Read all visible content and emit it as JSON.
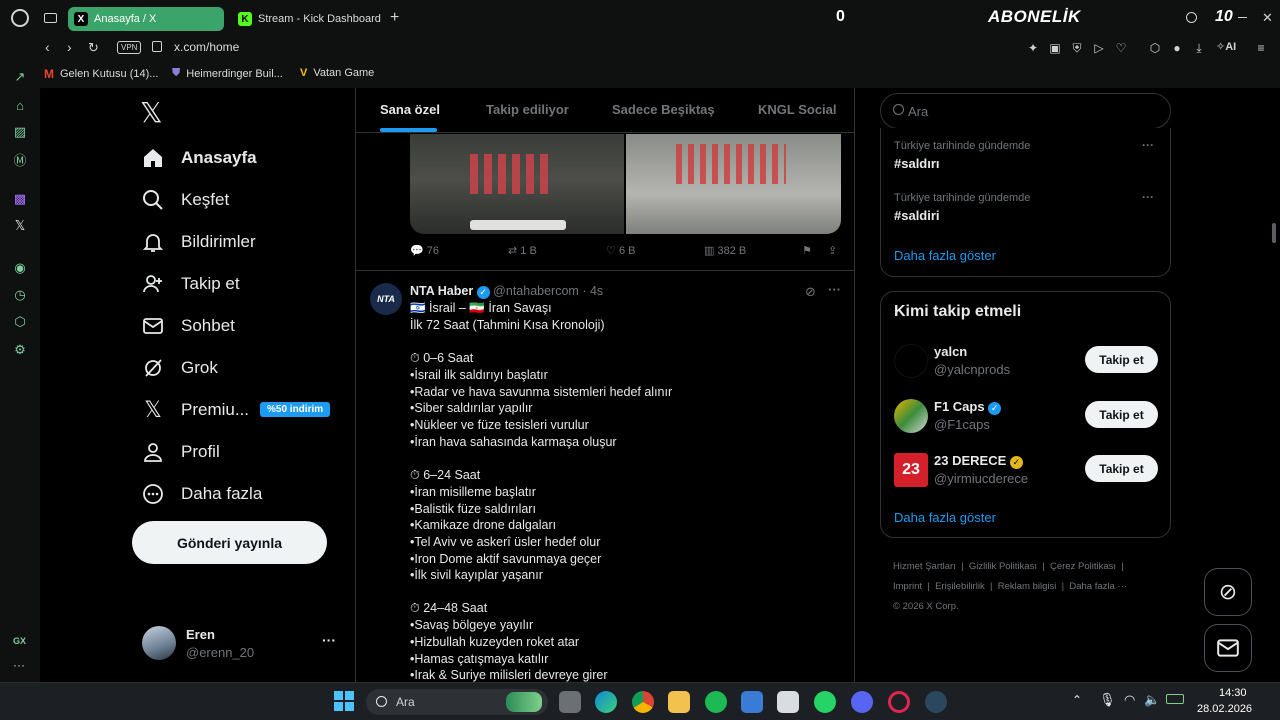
{
  "browser": {
    "tabs": [
      {
        "label": "Anasayfa / X",
        "favicon": "X"
      },
      {
        "label": "Stream - Kick Dashboard",
        "favicon": "K"
      }
    ],
    "add_tab": "+",
    "counter": "0",
    "banner_text": "ABONELİK",
    "search_badge": "10",
    "vpn_label": "VPN",
    "url": "x.com/home",
    "ai_label": "AI",
    "bookmarks": [
      {
        "label": "Gelen Kutusu (14)..."
      },
      {
        "label": "Heimerdinger Buil..."
      },
      {
        "label": "Vatan Game"
      }
    ],
    "gx_label": "GX",
    "accent_color": "#3aa46b"
  },
  "x": {
    "logo": "𝕏",
    "nav": [
      {
        "label": "Anasayfa",
        "icon": "home-icon"
      },
      {
        "label": "Keşfet",
        "icon": "search-icon"
      },
      {
        "label": "Bildirimler",
        "icon": "bell-icon"
      },
      {
        "label": "Takip et",
        "icon": "add-user-icon"
      },
      {
        "label": "Sohbet",
        "icon": "mail-icon"
      },
      {
        "label": "Grok",
        "icon": "grok-icon"
      },
      {
        "label": "Premiu...",
        "icon": "x-icon",
        "badge": "%50 indirim"
      },
      {
        "label": "Profil",
        "icon": "person-icon"
      },
      {
        "label": "Daha fazla",
        "icon": "more-circle-icon"
      }
    ],
    "post_button": "Gönderi yayınla",
    "account": {
      "name": "Eren",
      "handle": "@erenn_20",
      "more": "···"
    },
    "feed_tabs": [
      "Sana özel",
      "Takip ediliyor",
      "Sadece Beşiktaş",
      "KNGL Social"
    ],
    "prev_tweet_actions": {
      "replies": "76",
      "reposts": "1 B",
      "likes": "6 B",
      "views": "382 B"
    },
    "tweet": {
      "avatar_text": "NTA",
      "name": "NTA Haber",
      "handle": "@ntahabercom",
      "time": "· 4s",
      "more": "···",
      "lines": [
        "🇮🇱 İsrail – 🇮🇷 İran Savaşı",
        "İlk 72 Saat (Tahmini Kısa Kronoloji)",
        "",
        "⏱ 0–6 Saat",
        "•İsrail ilk saldırıyı başlatır",
        "•Radar ve hava savunma sistemleri hedef alınır",
        "•Siber saldırılar yapılır",
        "•Nükleer ve füze tesisleri vurulur",
        "•İran hava sahasında karmaşa oluşur",
        "",
        "⏱ 6–24 Saat",
        "•İran misilleme başlatır",
        "•Balistik füze saldırıları",
        "•Kamikaze drone dalgaları",
        "•Tel Aviv ve askerî üsler hedef olur",
        "•Iron Dome aktif savunmaya geçer",
        "•İlk sivil kayıplar yaşanır",
        "",
        "⏱ 24–48 Saat",
        "•Savaş bölgeye yayılır",
        "•Hizbullah kuzeyden roket atar",
        "•Hamas çatışmaya katılır",
        "•Irak & Suriye milisleri devreye girer"
      ]
    },
    "search_placeholder": "Ara",
    "trends": [
      {
        "context": "Türkiye tarihinde gündemde",
        "tag": "#saldırı"
      },
      {
        "context": "Türkiye tarihinde gündemde",
        "tag": "#saldiri"
      }
    ],
    "show_more": "Daha fazla göster",
    "who_to_follow": {
      "title": "Kimi takip etmeli",
      "users": [
        {
          "name": "yalcn",
          "handle": "@yalcnprods",
          "verified": false,
          "button": "Takip et"
        },
        {
          "name": "F1 Caps",
          "handle": "@F1caps",
          "verified": true,
          "button": "Takip et"
        },
        {
          "name": "23 DERECE",
          "handle": "@yirmiucderece",
          "verified": true,
          "avatar_text": "23",
          "button": "Takip et"
        }
      ],
      "show_more": "Daha fazla göster"
    },
    "footer": {
      "links": [
        "Hizmet Şartları",
        "Gizlilik Politikası",
        "Çerez Politikası",
        "Imprint",
        "Erişilebilirlik",
        "Reklam bilgisi",
        "Daha fazla ···"
      ],
      "copyright": "© 2026 X Corp."
    }
  },
  "taskbar": {
    "search_label": "Ara",
    "time": "14:30",
    "date": "28.02.2026"
  }
}
